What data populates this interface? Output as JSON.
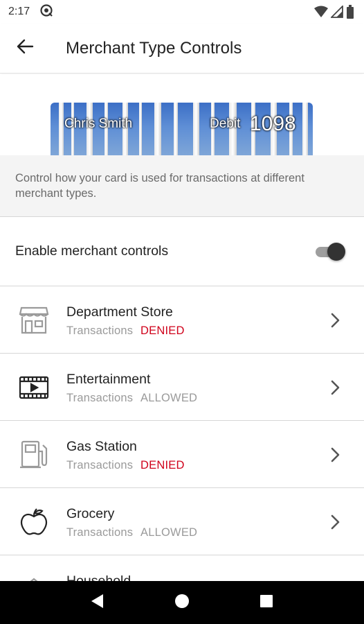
{
  "status_bar": {
    "time": "2:17"
  },
  "app_bar": {
    "title": "Merchant Type Controls"
  },
  "card": {
    "holder": "Chris Smith",
    "type": "Debit",
    "last4": "1098"
  },
  "description": "Control how your card is used for transactions at different merchant types.",
  "toggle": {
    "label": "Enable merchant controls",
    "enabled": true
  },
  "colors": {
    "denied": "#d0021b",
    "allowed": "#9a9a9a",
    "toggle_thumb": "#333333"
  },
  "merchants": [
    {
      "name": "Department Store",
      "label": "Transactions",
      "state": "DENIED",
      "icon": "storefront-icon"
    },
    {
      "name": "Entertainment",
      "label": "Transactions",
      "state": "ALLOWED",
      "icon": "movie-icon"
    },
    {
      "name": "Gas Station",
      "label": "Transactions",
      "state": "DENIED",
      "icon": "gas-pump-icon"
    },
    {
      "name": "Grocery",
      "label": "Transactions",
      "state": "ALLOWED",
      "icon": "apple-icon"
    },
    {
      "name": "Household",
      "label": "",
      "state": "",
      "icon": "home-icon"
    }
  ]
}
